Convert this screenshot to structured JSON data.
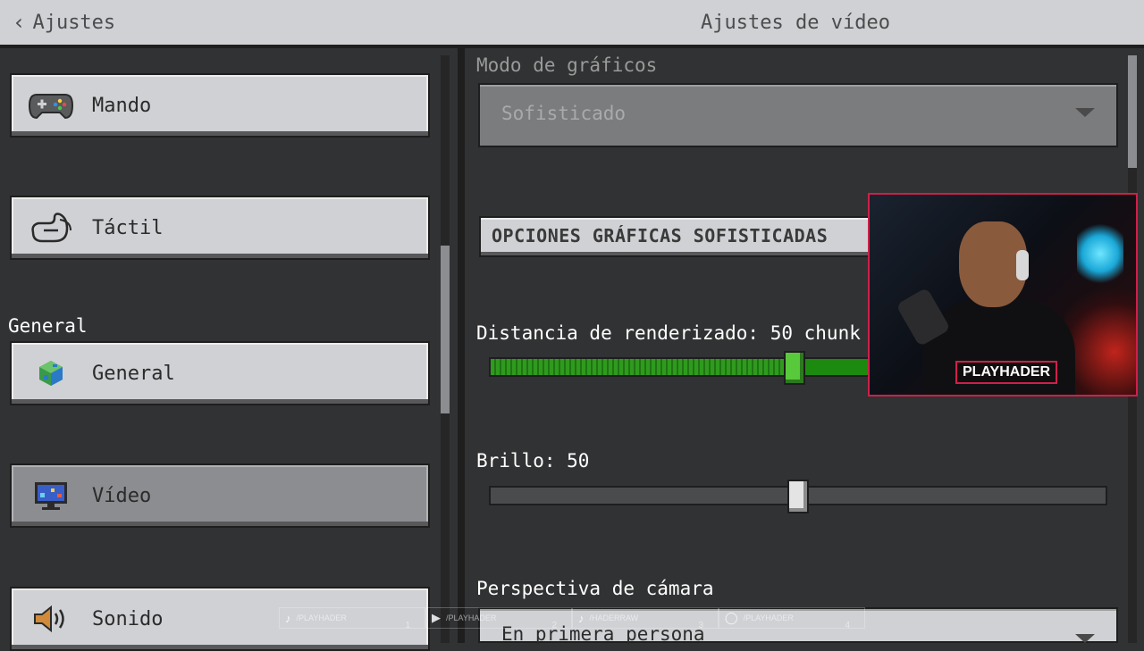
{
  "topbar": {
    "back_label": "Ajustes",
    "title": "Ajustes de vídeo"
  },
  "sidebar": {
    "items": [
      {
        "label": "Mando",
        "icon": "gamepad-icon"
      },
      {
        "label": "Táctil",
        "icon": "touch-hand-icon"
      },
      {
        "label": "General",
        "icon": "globe-icon"
      },
      {
        "label": "Vídeo",
        "icon": "monitor-icon",
        "selected": true
      },
      {
        "label": "Sonido",
        "icon": "speaker-icon"
      }
    ],
    "section_general": "General"
  },
  "video": {
    "graphics_mode_label": "Modo de gráficos",
    "graphics_mode_value": "Sofisticado",
    "fancy_options_button": "OPCIONES GRÁFICAS SOFISTICADAS",
    "render_distance_label": "Distancia de renderizado: 50 chunk",
    "render_distance_level": 0.49,
    "brightness_label": "Brillo: 50",
    "brightness_level": 0.5,
    "camera_perspective_label": "Perspectiva de cámara",
    "camera_perspective_value": "En primera persona"
  },
  "webcam": {
    "name_badge": "PLAYHADER"
  },
  "social": [
    {
      "icon": "tiktok-icon",
      "handle": "/PLAYHADER",
      "num": "1"
    },
    {
      "icon": "youtube-icon",
      "handle": "/PLAYHADER",
      "num": "2"
    },
    {
      "icon": "tiktok-icon",
      "handle": "/HADERRAW",
      "num": "3"
    },
    {
      "icon": "instagram-icon",
      "handle": "/PLAYHADER",
      "num": "4"
    }
  ],
  "colors": {
    "accent_green": "#2f9a1e",
    "webcam_border": "#d01f4a",
    "panel_bg": "#313233",
    "button_bg": "#d0d1d4"
  }
}
